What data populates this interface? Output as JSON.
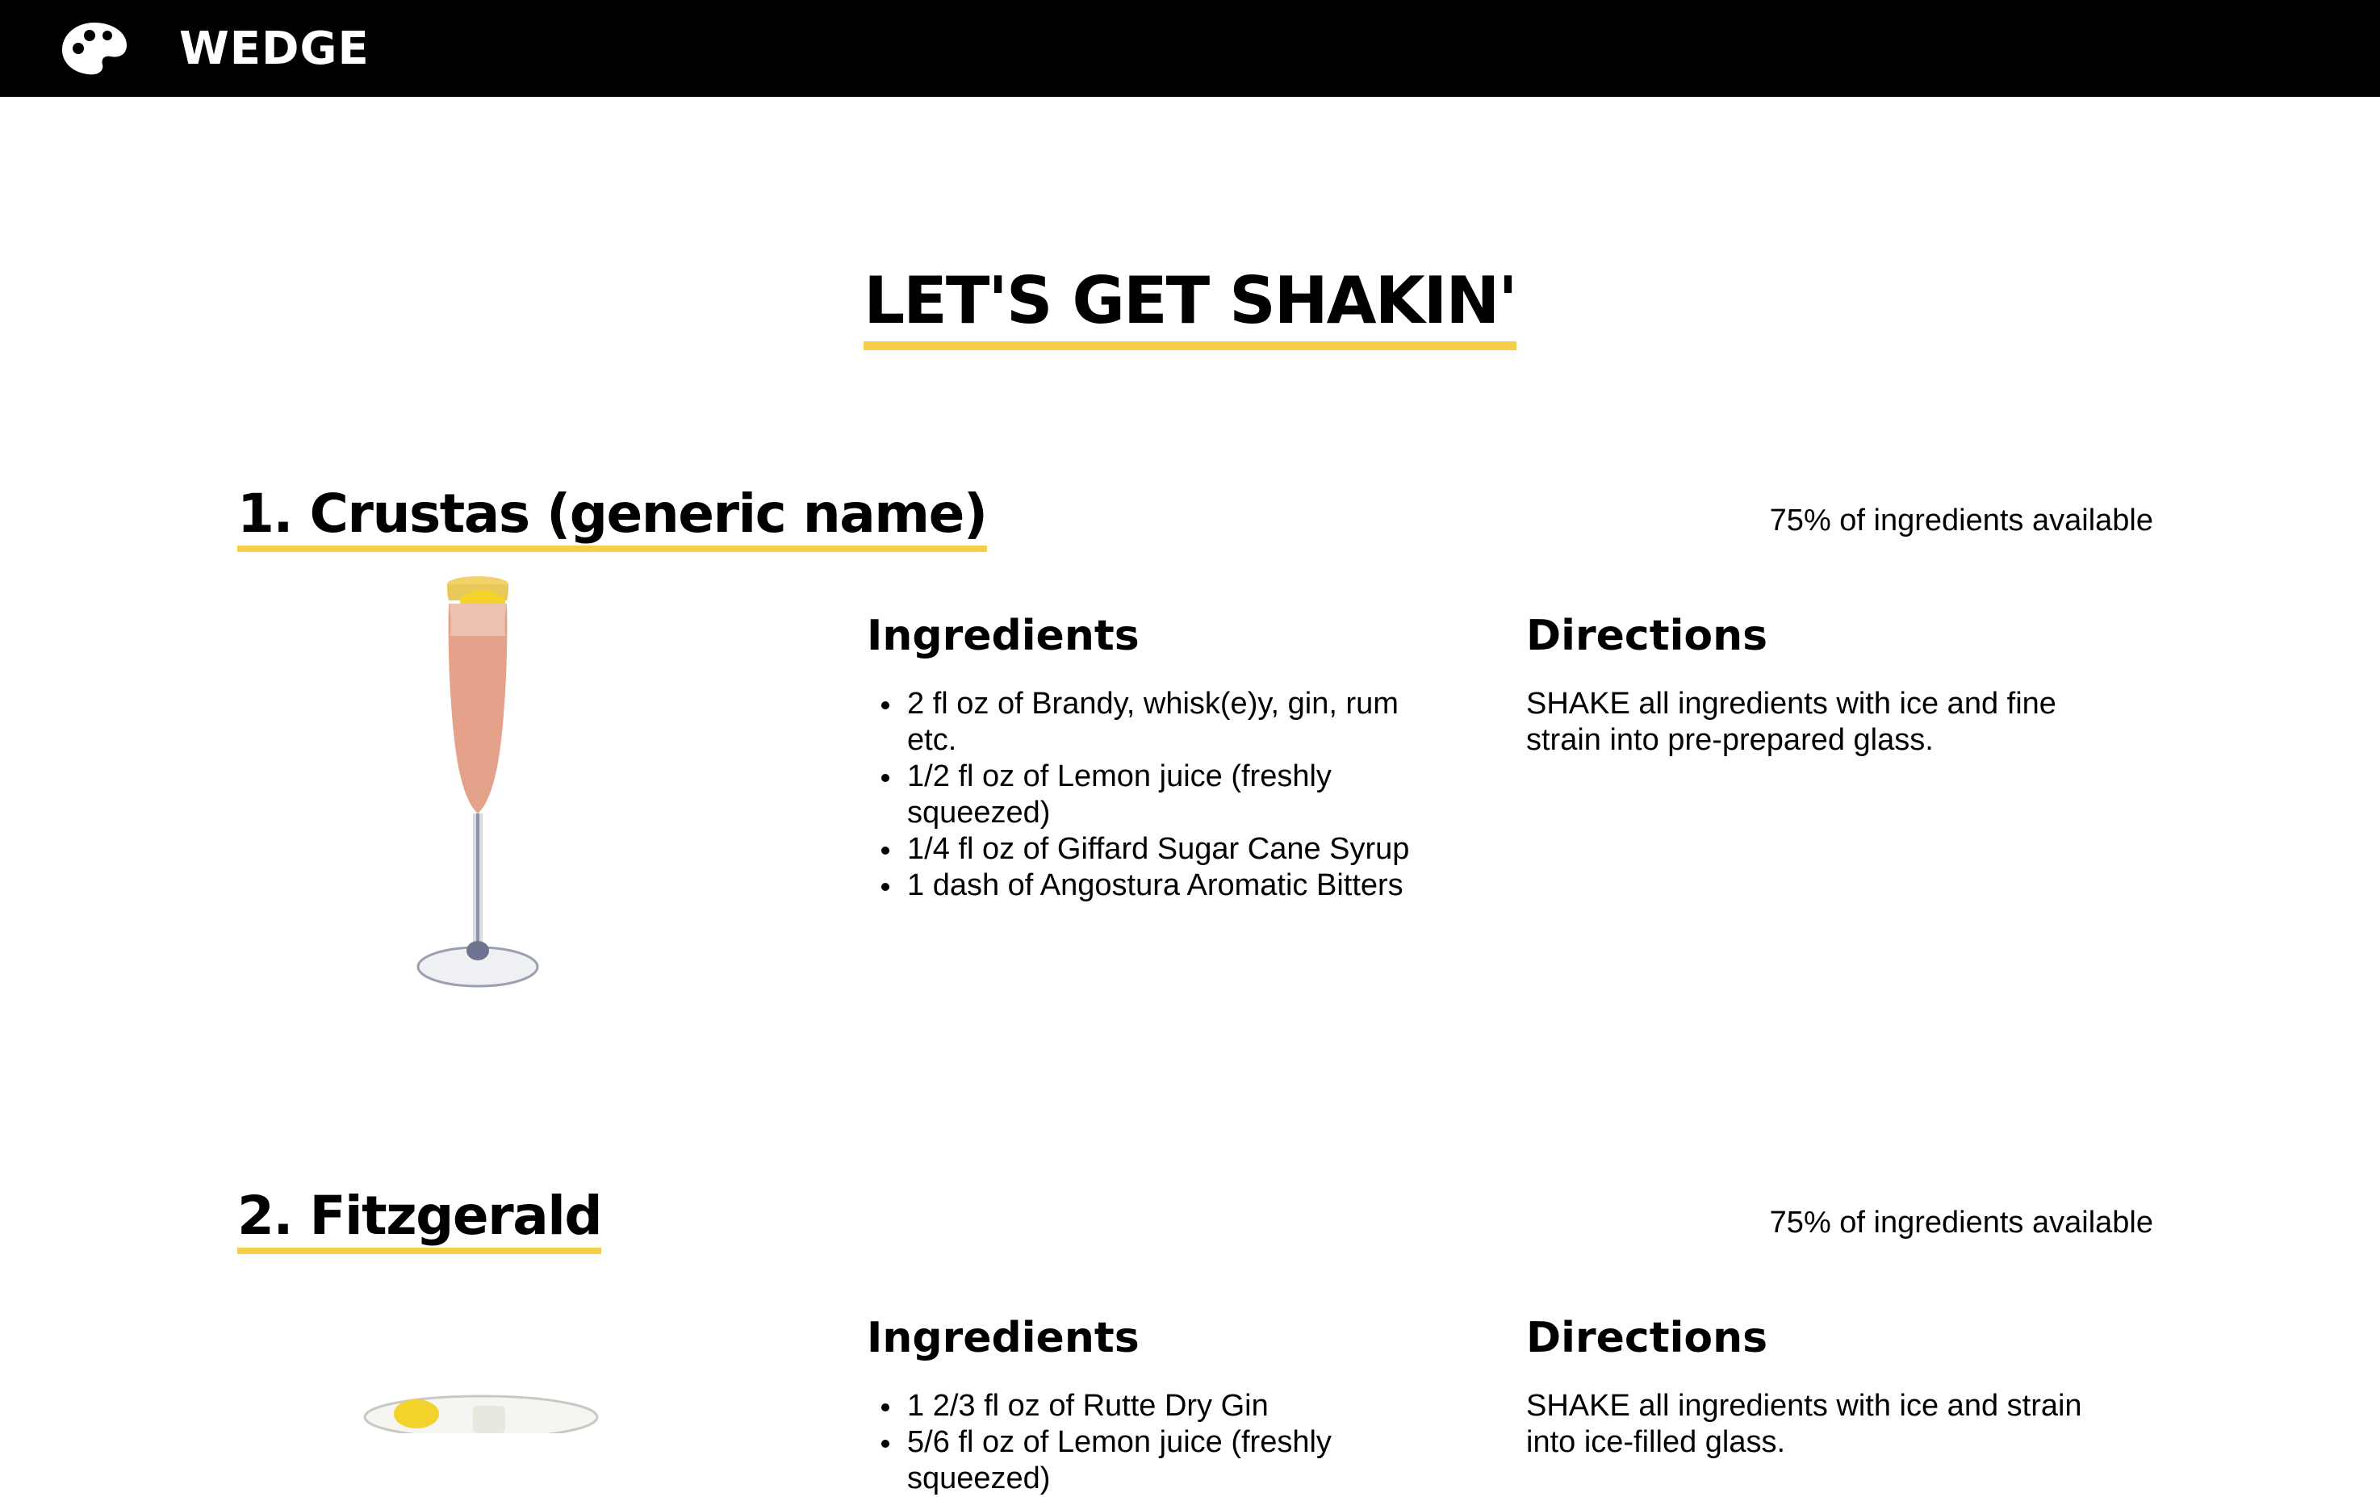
{
  "header": {
    "brand": "WEDGE",
    "logo_icon": "palette-icon"
  },
  "page": {
    "title": "LET'S GET SHAKIN'"
  },
  "colors": {
    "topbar": "#000000",
    "accent_underline": "#f6cf4a"
  },
  "recipes": [
    {
      "title": "1. Crustas (generic name)",
      "availability": "75% of ingredients available",
      "image_icon": "champagne-flute-cocktail-image",
      "ingredients_heading": "Ingredients",
      "ingredients": [
        "2 fl oz of Brandy, whisk(e)y, gin, rum etc.",
        "1/2 fl oz of Lemon juice (freshly squeezed)",
        "1/4 fl oz of Giffard Sugar Cane Syrup",
        "1 dash of Angostura Aromatic Bitters"
      ],
      "directions_heading": "Directions",
      "directions": "SHAKE all ingredients with ice and fine strain into pre-prepared glass."
    },
    {
      "title": "2. Fitzgerald",
      "availability": "75% of ingredients available",
      "image_icon": "rocks-glass-cocktail-image",
      "ingredients_heading": "Ingredients",
      "ingredients": [
        "1 2/3 fl oz of Rutte Dry Gin",
        "5/6 fl oz of Lemon juice (freshly squeezed)"
      ],
      "directions_heading": "Directions",
      "directions": "SHAKE all ingredients with ice and strain into ice-filled glass."
    }
  ]
}
